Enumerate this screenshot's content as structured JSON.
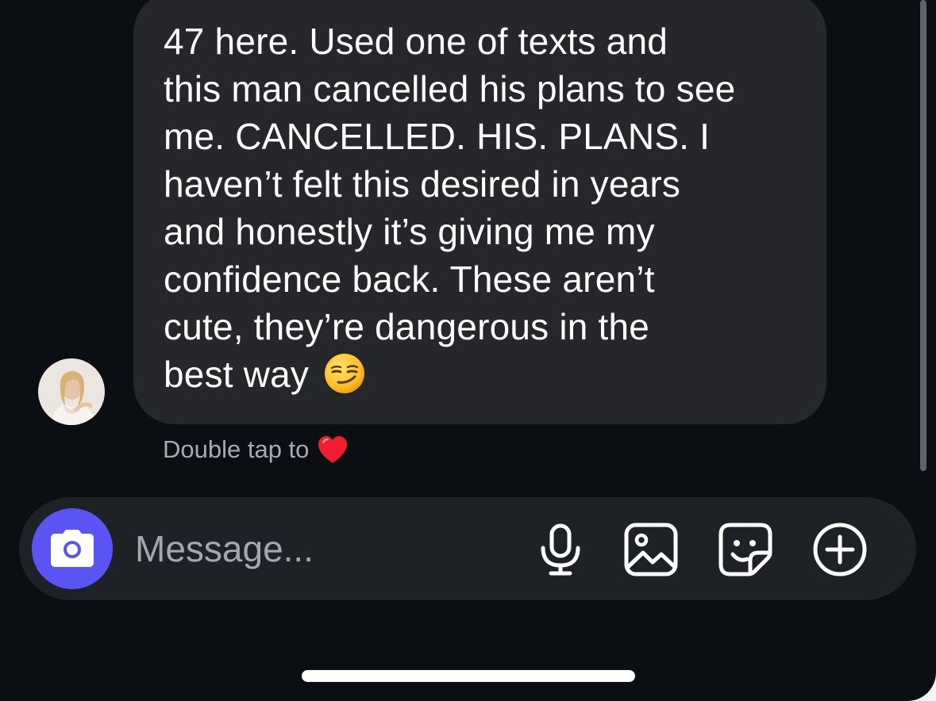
{
  "message": {
    "lines": [
      "47 here. Used one of  texts and",
      "this man cancelled his plans to see",
      "me. CANCELLED. HIS. PLANS. I",
      "haven’t felt this desired in years",
      "and honestly it’s giving me my",
      "confidence back. These aren’t",
      "cute, they’re dangerous in the",
      "best way"
    ],
    "trailing_emoji": "smirk-emoji"
  },
  "reaction_hint": {
    "label": "Double tap to",
    "icon": "red-heart-icon"
  },
  "composer": {
    "placeholder": "Message...",
    "camera_icon": "camera-icon",
    "tools": [
      "microphone-icon",
      "gallery-icon",
      "sticker-icon",
      "plus-icon"
    ]
  },
  "colors": {
    "background": "#0b0f14",
    "bubble": "#25272b",
    "composer": "#1e2126",
    "accent": "#5b54f4",
    "secondary_text": "#a6abb3"
  }
}
